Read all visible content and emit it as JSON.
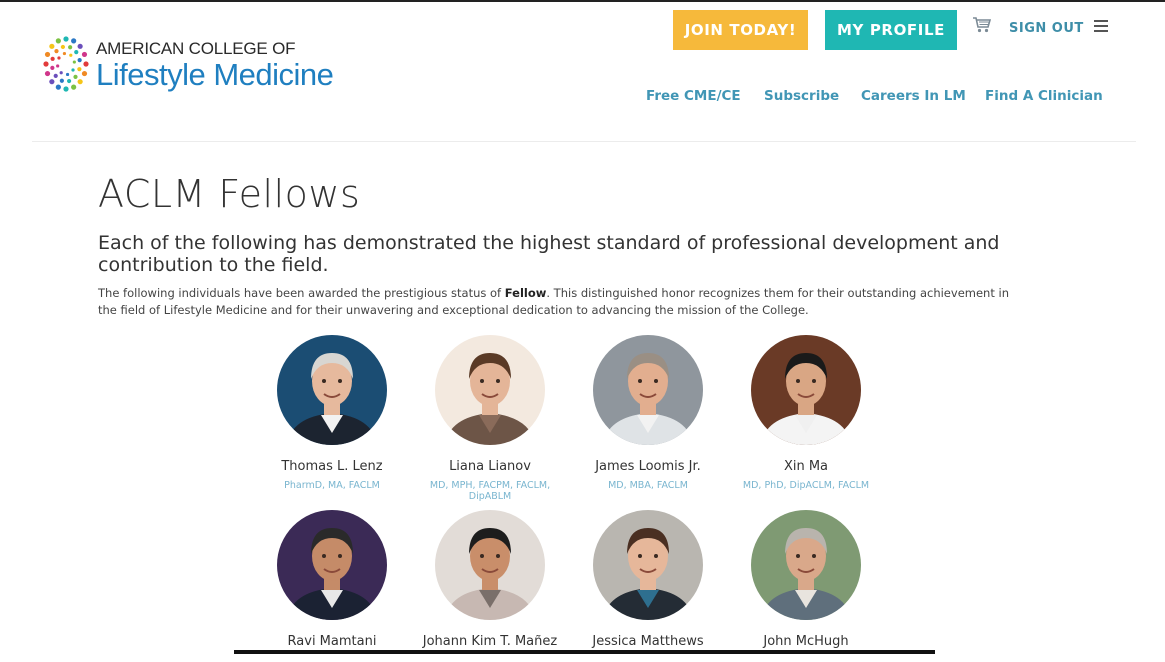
{
  "logo": {
    "line1": "AMERICAN COLLEGE OF",
    "line2": "Lifestyle Medicine"
  },
  "header": {
    "join_label": "JOIN TODAY!",
    "profile_label": "MY PROFILE",
    "signout_label": "SIGN OUT"
  },
  "nav": {
    "items": [
      {
        "label": "Free CME/CE"
      },
      {
        "label": "Subscribe"
      },
      {
        "label": "Careers In LM"
      },
      {
        "label": "Find A Clinician"
      }
    ]
  },
  "page": {
    "title": "ACLM Fellows",
    "subheading": "Each of the following has demonstrated the highest standard of professional development and contribution to the field.",
    "intro_before": "The following individuals have been awarded the prestigious status of ",
    "intro_bold": "Fellow",
    "intro_after": ". This distinguished honor recognizes them for their outstanding achievement in the field of Lifestyle Medicine and for their unwavering and exceptional dedication to advancing the mission of the College."
  },
  "fellows": [
    {
      "name": "Thomas L. Lenz",
      "credentials": "PharmD, MA, FACLM"
    },
    {
      "name": "Liana Lianov",
      "credentials": "MD, MPH, FACPM, FACLM, DipABLM"
    },
    {
      "name": "James Loomis Jr.",
      "credentials": "MD, MBA, FACLM"
    },
    {
      "name": "Xin Ma",
      "credentials": "MD, PhD, DipACLM, FACLM"
    },
    {
      "name": "Ravi Mamtani",
      "credentials": ""
    },
    {
      "name": "Johann Kim T. Mañez",
      "credentials": ""
    },
    {
      "name": "Jessica Matthews",
      "credentials": ""
    },
    {
      "name": "John McHugh",
      "credentials": ""
    }
  ],
  "colors": {
    "join_button": "#f6b93b",
    "profile_button": "#1fb7b3",
    "nav_link": "#4196b5",
    "logo_blue": "#1f7fc0",
    "credential_text": "#79b5cf"
  },
  "icons": {
    "cart": "shopping-cart-icon",
    "menu": "hamburger-menu-icon"
  }
}
